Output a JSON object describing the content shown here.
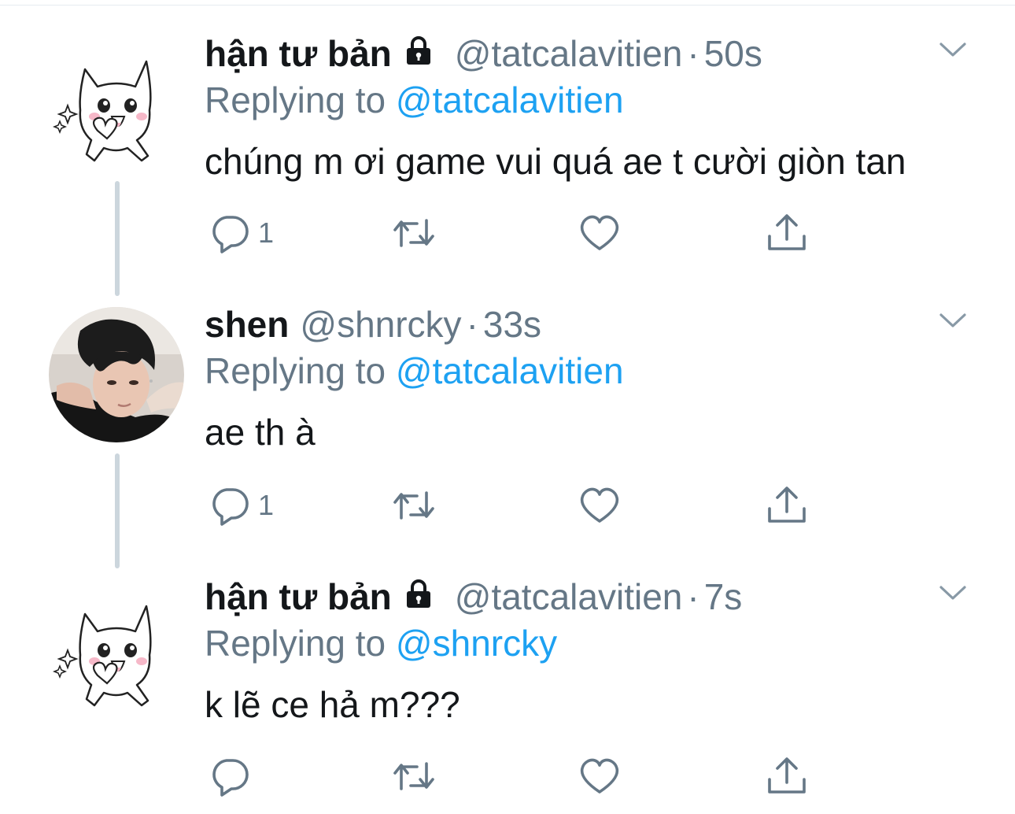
{
  "tweets": [
    {
      "display_name": "hận tư bản",
      "locked": true,
      "handle": "@tatcalavitien",
      "separator": "·",
      "time": "50s",
      "replying_prefix": "Replying to",
      "replying_to": "@tatcalavitien",
      "text": "chúng m ơi game vui quá ae t cười giòn tan",
      "reply_count": "1",
      "avatar": "cat-icon"
    },
    {
      "display_name": "shen",
      "locked": false,
      "handle": "@shnrcky",
      "separator": "·",
      "time": "33s",
      "replying_prefix": "Replying to",
      "replying_to": "@tatcalavitien",
      "text": "ae th à",
      "reply_count": "1",
      "avatar": "person-photo"
    },
    {
      "display_name": "hận tư bản",
      "locked": true,
      "handle": "@tatcalavitien",
      "separator": "·",
      "time": "7s",
      "replying_prefix": "Replying to",
      "replying_to": "@shnrcky",
      "text": "k lẽ ce hả m???",
      "reply_count": "",
      "avatar": "cat-icon"
    }
  ],
  "colors": {
    "text": "#14171a",
    "secondary": "#657786",
    "link": "#1da1f2",
    "thread_line": "#ccd6dd"
  },
  "icons": [
    "reply-icon",
    "retweet-icon",
    "like-icon",
    "share-icon",
    "chevron-down-icon",
    "lock-icon"
  ]
}
